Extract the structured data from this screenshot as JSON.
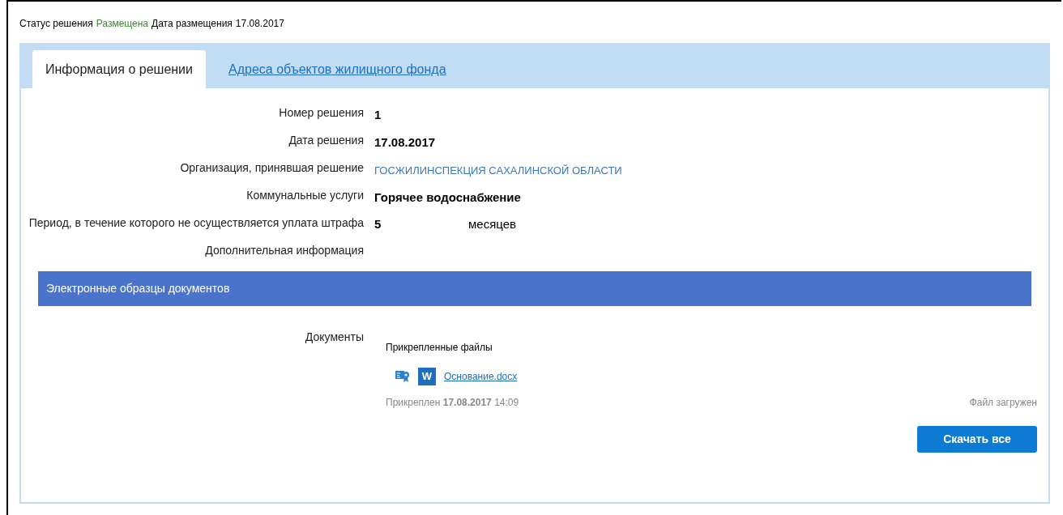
{
  "status": {
    "label": "Статус решения",
    "value": "Размещена",
    "date_label": "Дата размещения",
    "date": "17.08.2017"
  },
  "tabs": [
    {
      "label": "Информация о решении",
      "selected": true
    },
    {
      "label": "Адреса объектов жилищного фонда",
      "selected": false
    }
  ],
  "fields": [
    {
      "label": "Номер решения",
      "kind": "bold",
      "value": "1"
    },
    {
      "label": "Дата решения",
      "kind": "bold",
      "value": "17.08.2017"
    },
    {
      "label": "Организация, принявшая решение",
      "kind": "link",
      "value": "ГОСЖИЛИНСПЕКЦИЯ САХАЛИНСКОЙ ОБЛАСТИ"
    },
    {
      "label": "Коммунальные услуги",
      "kind": "bold",
      "value": "Горячее водоснабжение"
    },
    {
      "label": "Период, в течение которого не осуществляется уплата штрафа",
      "kind": "period",
      "value": "5",
      "unit": "месяцев"
    },
    {
      "label": "Дополнительная информация",
      "kind": "empty"
    }
  ],
  "section": {
    "title": "Электронные образцы документов"
  },
  "documents": {
    "label": "Документы",
    "subtitle": "Прикрепленные файлы",
    "files": [
      {
        "name": "Основание.docx",
        "type_badge": "W",
        "attached": "Прикреплен **17.08.2017** 14:09",
        "status": "Файл загружен"
      }
    ],
    "download_button": "Скачать все"
  }
}
